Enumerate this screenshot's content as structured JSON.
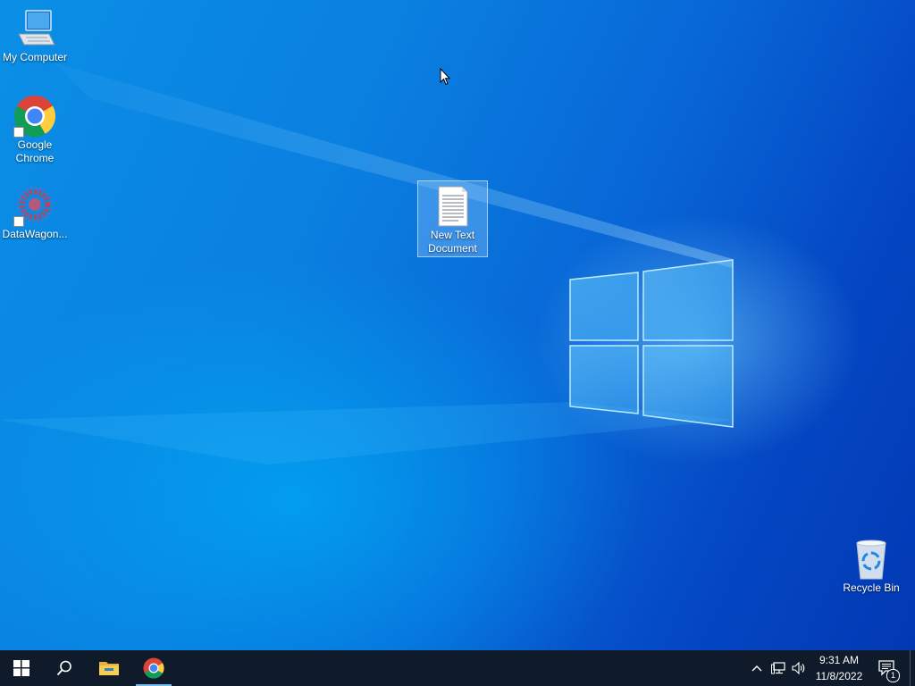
{
  "desktop": {
    "icons": [
      {
        "label": "My Computer",
        "icon": "computer-icon"
      },
      {
        "label": "Google Chrome",
        "icon": "chrome-icon"
      },
      {
        "label": "DataWagon...",
        "icon": "datawagon-icon"
      },
      {
        "label": "New Text Document",
        "icon": "text-document-icon"
      },
      {
        "label": "Recycle Bin",
        "icon": "recycle-bin-icon"
      }
    ]
  },
  "taskbar": {
    "items": [
      {
        "name": "start-button",
        "icon": "windows-logo-icon"
      },
      {
        "name": "search-button",
        "icon": "search-icon"
      },
      {
        "name": "file-explorer-button",
        "icon": "folder-icon"
      },
      {
        "name": "chrome-taskbar-button",
        "icon": "chrome-icon",
        "active": true
      }
    ],
    "tray": {
      "icons": [
        "chevron-up-icon",
        "network-icon",
        "volume-icon"
      ],
      "time": "9:31 AM",
      "date": "11/8/2022",
      "notification_count": "1"
    }
  },
  "colors": {
    "taskbar": "#0f1a2a",
    "wallpaper_accent": "#0a7fe0",
    "active_indicator": "#76b9ed"
  }
}
